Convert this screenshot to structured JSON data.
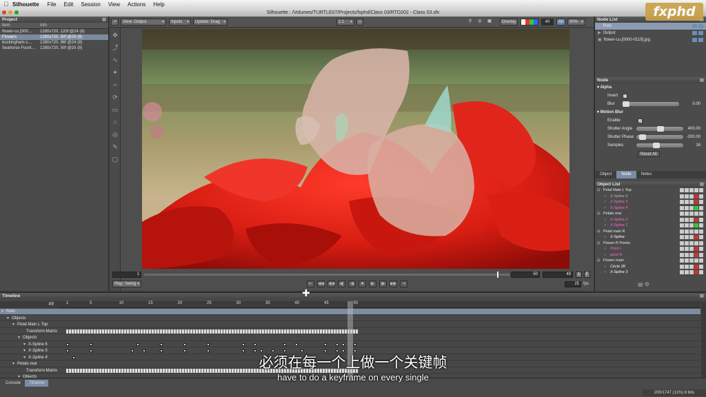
{
  "menubar": {
    "app": "Silhouette",
    "items": [
      "File",
      "Edit",
      "Session",
      "View",
      "Actions",
      "Help"
    ]
  },
  "window_title": "Silhouette : /Volumes/TURTLE07/Projects/fxphd/Class 03/RTO202 - Class 03.sfx",
  "logo_text": "fxphd",
  "project": {
    "header": "Project",
    "col_item": "Item",
    "col_info": "Info",
    "rows": [
      {
        "item": "flower-cu.[000…",
        "info": "1280x720, 120f @24 (8)"
      },
      {
        "item": "Flowers",
        "info": "1280x720, 50f @25 (8)"
      },
      {
        "item": "buckingham-s…",
        "info": "1280x720, 96f @24 (8)"
      },
      {
        "item": "Seahorse Fount…",
        "info": "1280x720, 50f @25 (8)"
      }
    ]
  },
  "viewer": {
    "view_select": "View: Output",
    "inputs_select": "Inputs",
    "update_select": "Update: Drag",
    "ratio_select": "1:1",
    "overlay_label": "Overlay",
    "overlay_value": "40",
    "alpha_label": "All",
    "zoom_select": "90%",
    "frame_start": "1",
    "frame_mid": "50",
    "frame_cur": "49",
    "frame_one": "1",
    "frame_f": "F",
    "play_mode": "Play: Swing",
    "fps": "25",
    "fps_unit": "fps"
  },
  "node_list": {
    "header": "Node List",
    "items": [
      "Roto",
      "Output",
      "flower-cu.[0000-0119].jpg"
    ]
  },
  "node": {
    "header": "Node",
    "alpha_section": "Alpha",
    "invert_label": "Invert",
    "blur_label": "Blur",
    "blur_value": "0.00",
    "blur_level": 0,
    "motion_blur_section": "Motion Blur",
    "enable_label": "Enable",
    "shutter_angle_label": "Shutter Angle",
    "shutter_angle_value": "400.00",
    "shutter_phase_label": "Shutter Phase",
    "shutter_phase_value": "-200.00",
    "samples_label": "Samples",
    "samples_value": "16",
    "reset_label": "Reset All"
  },
  "tabs": [
    "Object",
    "Node",
    "Notes"
  ],
  "object_list": {
    "header": "Object List",
    "rows": [
      {
        "name": "Petal Main L Top",
        "indent": 1,
        "group": true
      },
      {
        "name": "X-Spline 6",
        "indent": 2,
        "group": false,
        "color": "#bbbbbb"
      },
      {
        "name": "X-Spline 5",
        "indent": 2,
        "group": false,
        "color": "#ff66cc"
      },
      {
        "name": "X-Spline 4",
        "indent": 2,
        "group": false,
        "color": "#ff66cc"
      },
      {
        "name": "Petals rear",
        "indent": 1,
        "group": true
      },
      {
        "name": "X-Spline 2",
        "indent": 2,
        "group": false,
        "color": "#ff66cc"
      },
      {
        "name": "X-Spline 1",
        "indent": 2,
        "group": false,
        "color": "#ff66cc"
      },
      {
        "name": "Petal main R",
        "indent": 1,
        "group": true
      },
      {
        "name": "X-Spline",
        "indent": 2,
        "group": false,
        "color": "#ffffff"
      },
      {
        "name": "Flower R Points",
        "indent": 1,
        "group": true
      },
      {
        "name": "Point L",
        "indent": 2,
        "group": false,
        "color": "#ff66cc"
      },
      {
        "name": "point R",
        "indent": 2,
        "group": false,
        "color": "#ff66cc"
      },
      {
        "name": "Flower main",
        "indent": 1,
        "group": true
      },
      {
        "name": "Circle 28",
        "indent": 2,
        "group": false,
        "color": "#ffffff"
      },
      {
        "name": "X-Spline 3",
        "indent": 2,
        "group": false,
        "color": "#ffffff"
      }
    ]
  },
  "timeline": {
    "header": "Timeline",
    "current_frame": "49",
    "ticks": [
      "1",
      "5",
      "10",
      "15",
      "20",
      "25",
      "30",
      "35",
      "40",
      "45",
      "50"
    ],
    "rows": [
      {
        "label": "Roto",
        "indent": 0,
        "sel": true
      },
      {
        "label": "Objects",
        "indent": 1
      },
      {
        "label": "Petal Main L Top",
        "indent": 2
      },
      {
        "label": "Transform:Matrix",
        "indent": 3,
        "right": true
      },
      {
        "label": "Objects",
        "indent": 3
      },
      {
        "label": "X-Spline 6",
        "indent": 4
      },
      {
        "label": "X-Spline 5",
        "indent": 4,
        "italic": true
      },
      {
        "label": "X-Spline 4",
        "indent": 4,
        "italic": true
      },
      {
        "label": "Petals rear",
        "indent": 2
      },
      {
        "label": "Transform:Matrix",
        "indent": 3,
        "right": true
      },
      {
        "label": "Objects",
        "indent": 3
      }
    ]
  },
  "bottom_tabs": [
    "Console",
    "Timeline"
  ],
  "status": "200/1747 (11%) 8 bits",
  "subtitle_zh": "必须在每一个上做一个关键帧",
  "subtitle_en": "have to do a keyframe on every single"
}
